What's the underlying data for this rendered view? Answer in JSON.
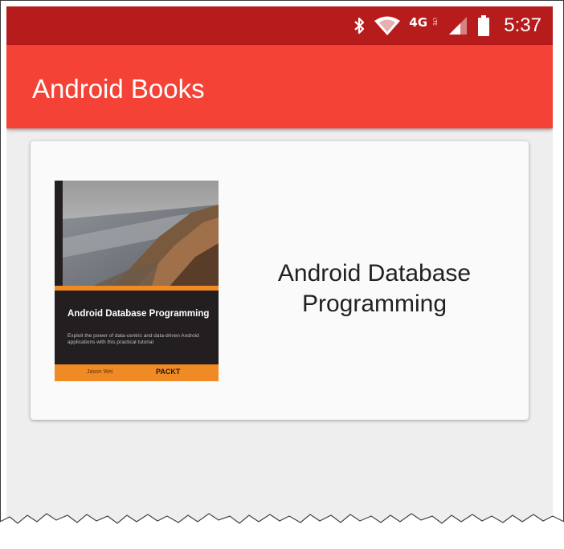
{
  "status_bar": {
    "icons": [
      "bluetooth-icon",
      "wifi-icon",
      "lte-signal-icon",
      "cell-signal-icon",
      "battery-icon"
    ],
    "network_label": "4G",
    "network_sub_label": "LTE",
    "time": "5:37",
    "color": "#b71c1c"
  },
  "app_bar": {
    "title": "Android Books",
    "color": "#f44336"
  },
  "book_card": {
    "title": "Android Database Programming",
    "cover": {
      "title": "Android Database Programming",
      "description": "Exploit the power of data-centric and data-driven Android applications with this practical tutorial",
      "author": "Jason Wei",
      "publisher": "PACKT",
      "accent_color": "#f08a24"
    }
  }
}
